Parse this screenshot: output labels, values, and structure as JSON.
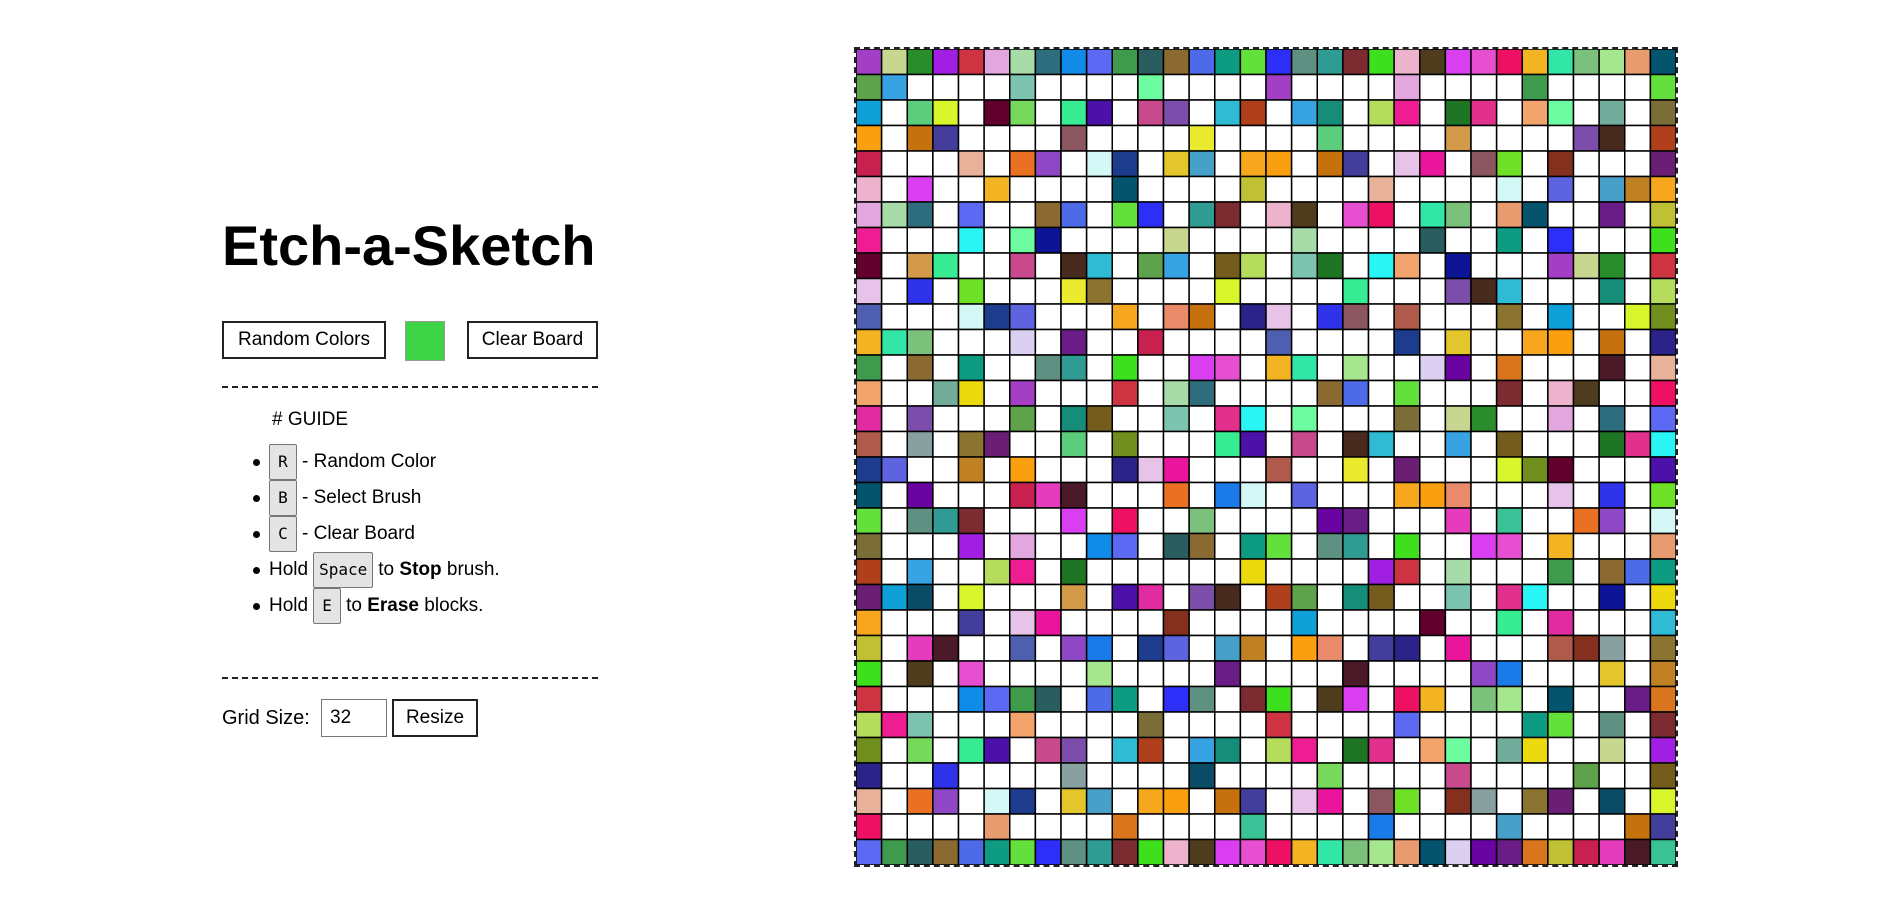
{
  "title": "Etch-a-Sketch",
  "controls": {
    "random_colors_label": "Random Colors",
    "current_color": "#3fd447",
    "clear_board_label": "Clear Board"
  },
  "guide": {
    "heading": "# GUIDE",
    "items": [
      {
        "key": "R",
        "prefix": "",
        "suffix": "- Random Color",
        "bold": "",
        "end": ""
      },
      {
        "key": "B",
        "prefix": "",
        "suffix": "- Select Brush",
        "bold": "",
        "end": ""
      },
      {
        "key": "C",
        "prefix": "",
        "suffix": "- Clear Board",
        "bold": "",
        "end": ""
      },
      {
        "key": "Space",
        "prefix": "Hold",
        "suffix": "to",
        "bold": "Stop",
        "end": "brush."
      },
      {
        "key": "E",
        "prefix": "Hold",
        "suffix": "to",
        "bold": "Erase",
        "end": "blocks."
      }
    ]
  },
  "grid": {
    "label": "Grid Size:",
    "size": "32",
    "resize_label": "Resize",
    "rows": 32,
    "cols": 32
  },
  "board": {
    "cell_border_color": "#000000",
    "empty_color": "#ffffff",
    "palette": [
      "#a33fc4",
      "#a7dca8",
      "#8b6a32",
      "#2f9b92",
      "#e64fcf",
      "#e99b70",
      "#c0c035",
      "#4f5fb0",
      "#5e63e0",
      "#e98a6b",
      "#2e32e8",
      "#eaea2f",
      "#d9f52c",
      "#4c11a8",
      "#b03f1c",
      "#ee1d91",
      "#6dfc9f",
      "#c8d790",
      "#2e6d7e",
      "#4d6be8",
      "#7c2c30",
      "#ee1063",
      "#03546c",
      "#c8214f",
      "#ea7124",
      "#e3c62b",
      "#c5710d",
      "#8b5660",
      "#8b7430",
      "#6f8e1e",
      "#e02ca0",
      "#5ea34b",
      "#7dc4b0",
      "#0d1495",
      "#2a8d2b",
      "#118be8",
      "#0d9b82",
      "#3ee01d",
      "#f3b423",
      "#dcd0f2",
      "#e43cbd",
      "#8e48c5",
      "#47a0c8",
      "#433e9b",
      "#6ee025",
      "#6a1f74",
      "#63012e",
      "#c94a8c",
      "#38a3e2",
      "#1e7625",
      "#72ad9c",
      "#a11fe2",
      "#5c6af3",
      "#64e03c",
      "#edb2cc",
      "#31e6a6",
      "#6904a2",
      "#4a1a29",
      "#1a7ae8",
      "#bf8124",
      "#2b2389",
      "#af5a4b",
      "#0fa0d8",
      "#76d95b",
      "#7c4dab",
      "#158d78",
      "#e2318c",
      "#ecd90e",
      "#cd3341",
      "#3e9b4d",
      "#2d2ef8",
      "#4f3c1c",
      "#7cc17b",
      "#6a1d87",
      "#3bc196",
      "#d3f8f5",
      "#f6a71e",
      "#e7c3ea",
      "#85301e",
      "#0a4b66",
      "#d29a48",
      "#482a1f",
      "#745d1c",
      "#29f5f5",
      "#7a6d38",
      "#e2a7df",
      "#2a5d60",
      "#5f9183",
      "#d93ff0",
      "#a5e78f",
      "#d9761d",
      "#e8b19a",
      "#1e3c8e",
      "#fa9f0f",
      "#e9159c",
      "#89a0a0",
      "#5bcd7c",
      "#38ec93",
      "#2ebbd3",
      "#b6dc5d",
      "#f2a46c"
    ]
  }
}
